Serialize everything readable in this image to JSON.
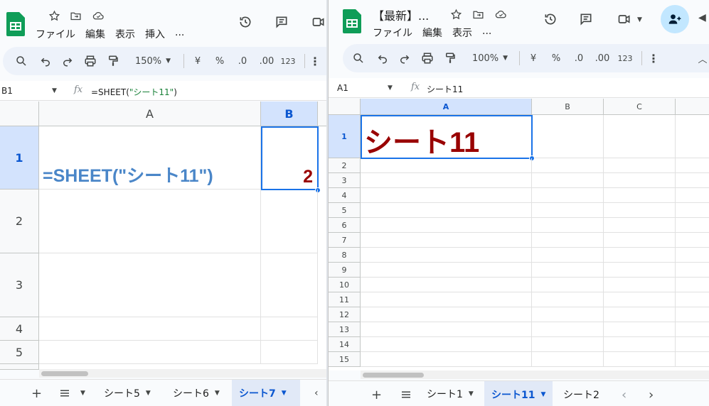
{
  "left": {
    "menu": [
      "ファイル",
      "編集",
      "表示",
      "挿入",
      "..."
    ],
    "zoom": "150%",
    "tb_currency": "¥",
    "tb_percent": "%",
    "tb_dec1": ".0",
    "tb_dec2": ".00",
    "tb_num": "123",
    "name_box": "B1",
    "formula_prefix": "=SHEET(",
    "formula_string": "\"シート11\"",
    "formula_suffix": ")",
    "col_a": "A",
    "col_b": "B",
    "rows": [
      "1",
      "2",
      "3",
      "4",
      "5"
    ],
    "a1_text": "=SHEET(\"シート11\")",
    "b1_value": "2",
    "tabs": [
      "シート5",
      "シート6",
      "シート7"
    ],
    "active_tab": "シート7"
  },
  "right": {
    "title": "【最新】...",
    "menu": [
      "ファイル",
      "編集",
      "表示",
      "..."
    ],
    "zoom": "100%",
    "tb_currency": "¥",
    "tb_percent": "%",
    "tb_dec1": ".0",
    "tb_dec2": ".00",
    "tb_num": "123",
    "name_box": "A1",
    "formula": "シート11",
    "cols": [
      "A",
      "B",
      "C"
    ],
    "rows": [
      "1",
      "2",
      "3",
      "4",
      "5",
      "6",
      "7",
      "8",
      "9",
      "10",
      "11",
      "12",
      "13",
      "14",
      "15"
    ],
    "a1_text": "シート11",
    "tabs": [
      "シート1",
      "シート11",
      "シート2"
    ],
    "active_tab": "シート11"
  },
  "colors": {
    "accent": "#0b57d0",
    "sheets_green": "#0f9d58",
    "cell_text_red": "#990000",
    "formula_blue": "#4a86c8"
  }
}
